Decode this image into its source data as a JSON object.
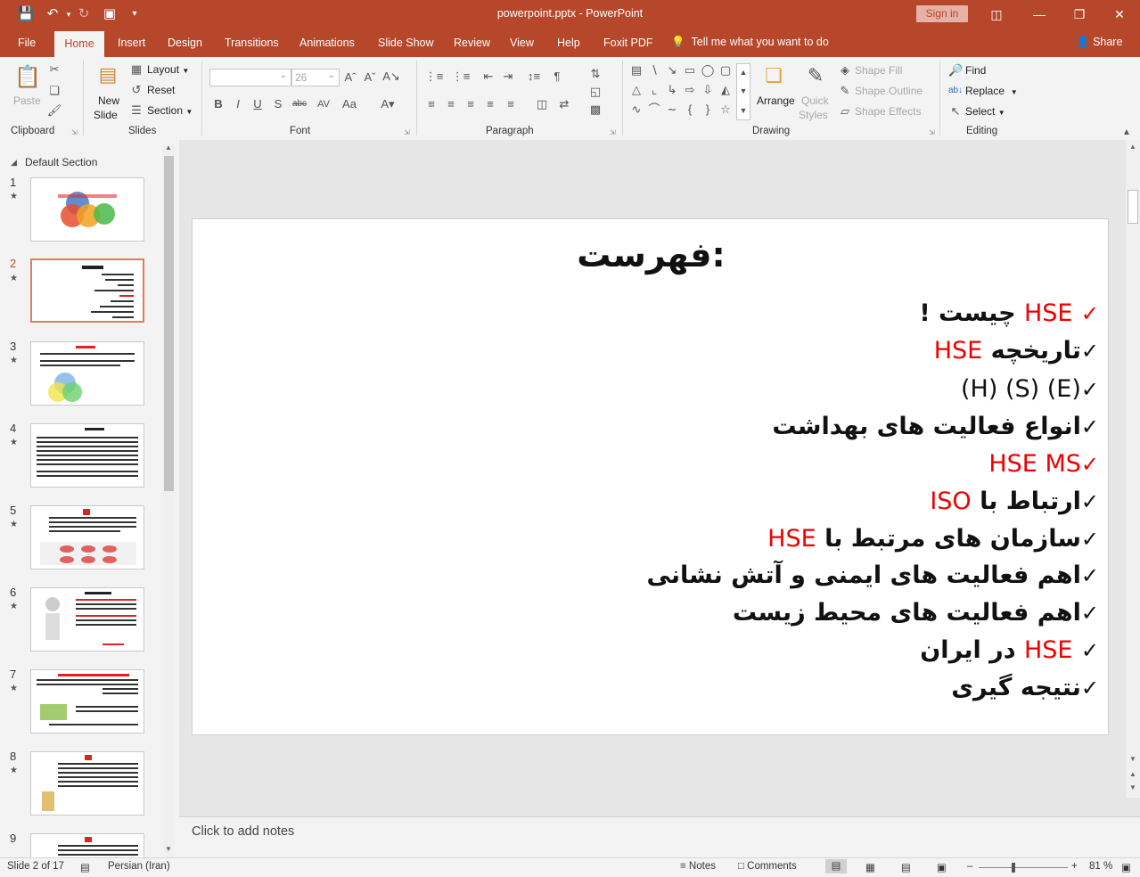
{
  "window": {
    "title": "powerpoint.pptx  -  PowerPoint",
    "signin_label": "Sign in"
  },
  "tabs": [
    {
      "label": "File"
    },
    {
      "label": "Home"
    },
    {
      "label": "Insert"
    },
    {
      "label": "Design"
    },
    {
      "label": "Transitions"
    },
    {
      "label": "Animations"
    },
    {
      "label": "Slide Show"
    },
    {
      "label": "Review"
    },
    {
      "label": "View"
    },
    {
      "label": "Help"
    },
    {
      "label": "Foxit PDF"
    }
  ],
  "tellme": "Tell me what you want to do",
  "share_label": "Share",
  "ribbon": {
    "clipboard": {
      "label": "Clipboard",
      "paste": "Paste"
    },
    "slides": {
      "label": "Slides",
      "new_slide": "New",
      "new_slide2": "Slide",
      "layout": "Layout",
      "reset": "Reset",
      "section": "Section"
    },
    "font": {
      "label": "Font",
      "size": "26"
    },
    "paragraph": {
      "label": "Paragraph"
    },
    "drawing": {
      "label": "Drawing",
      "arrange": "Arrange",
      "quick_styles": "Quick",
      "quick_styles2": "Styles",
      "shape_fill": "Shape Fill",
      "shape_outline": "Shape Outline",
      "shape_effects": "Shape Effects"
    },
    "editing": {
      "label": "Editing",
      "find": "Find",
      "replace": "Replace",
      "select": "Select"
    }
  },
  "panel": {
    "section": "Default Section",
    "thumbnails": [
      {
        "num": "1"
      },
      {
        "num": "2"
      },
      {
        "num": "3"
      },
      {
        "num": "4"
      },
      {
        "num": "5"
      },
      {
        "num": "6"
      },
      {
        "num": "7"
      },
      {
        "num": "8"
      },
      {
        "num": "9"
      }
    ]
  },
  "slide": {
    "title": "فهرست:",
    "bullets": [
      {
        "pre": "",
        "red": "HSE",
        "post": " چیست !",
        "check_red": true
      },
      {
        "pre": "تاریخچه ",
        "red": "HSE",
        "post": ""
      },
      {
        "pre": "(H) (S) (E)",
        "red": "",
        "post": ""
      },
      {
        "pre": "انواع فعالیت های بهداشت",
        "red": "",
        "post": ""
      },
      {
        "pre": "",
        "red": "HSE MS",
        "post": "",
        "check_red": true
      },
      {
        "pre": "ارتباط با ",
        "red": "ISO",
        "post": ""
      },
      {
        "pre": "سازمان های مرتبط با ",
        "red": "HSE",
        "post": ""
      },
      {
        "pre": "اهم فعالیت های ایمنی و آتش نشانی",
        "red": "",
        "post": ""
      },
      {
        "pre": "اهم فعالیت های محیط زیست",
        "red": "",
        "post": ""
      },
      {
        "pre": "",
        "red": "HSE",
        "post": "  در ایران"
      },
      {
        "pre": "نتیجه گیری",
        "red": "",
        "post": ""
      }
    ]
  },
  "notes_placeholder": "Click to add notes",
  "status": {
    "slide_count": "Slide 2 of 17",
    "language": "Persian (Iran)",
    "notes": "Notes",
    "comments": "Comments",
    "zoom": "81 %"
  },
  "colors": {
    "brand": "#b7472a",
    "accent_red": "#e00000",
    "selected_thumb": "#e77a5b"
  }
}
